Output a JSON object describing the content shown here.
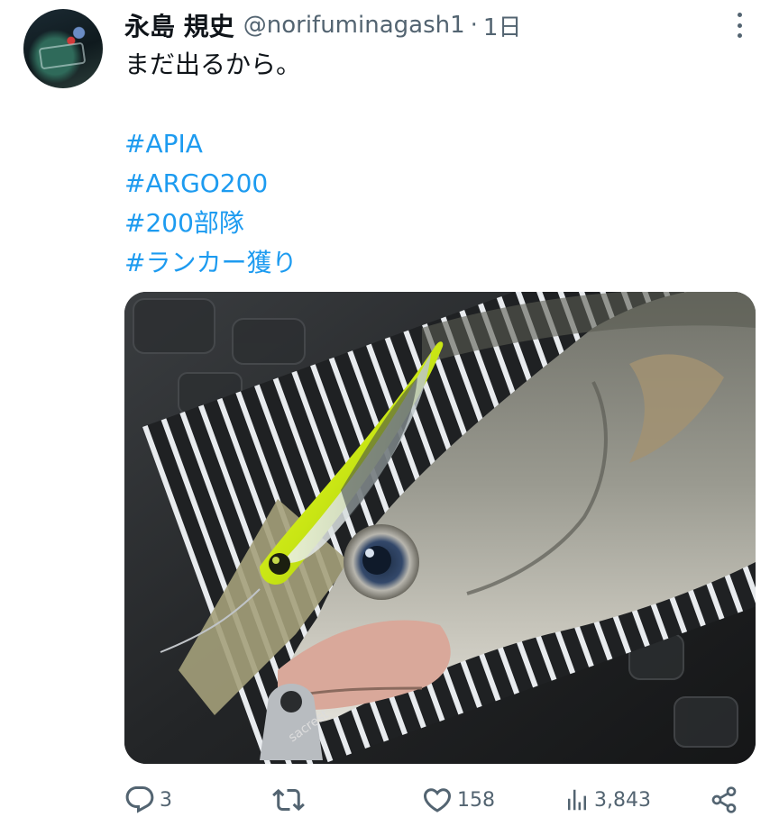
{
  "author": {
    "display_name": "永島 規史",
    "handle": "@norifuminagash1",
    "separator": "·",
    "time": "1日"
  },
  "tweet": {
    "text_line": "まだ出るから。",
    "hashtags": [
      "#APIA",
      "#ARGO200",
      "#200部隊",
      "#ランカー獲り"
    ]
  },
  "media": {
    "image_text": "sacrest"
  },
  "actions": {
    "reply_count": "3",
    "retweet_count": "",
    "like_count": "158",
    "view_count": "3,843"
  },
  "colors": {
    "accent": "#1d9bf0",
    "secondary_text": "#536471",
    "primary_text": "#0f1419"
  },
  "icons": [
    "more-icon",
    "reply-icon",
    "retweet-icon",
    "like-icon",
    "views-icon",
    "share-icon"
  ]
}
